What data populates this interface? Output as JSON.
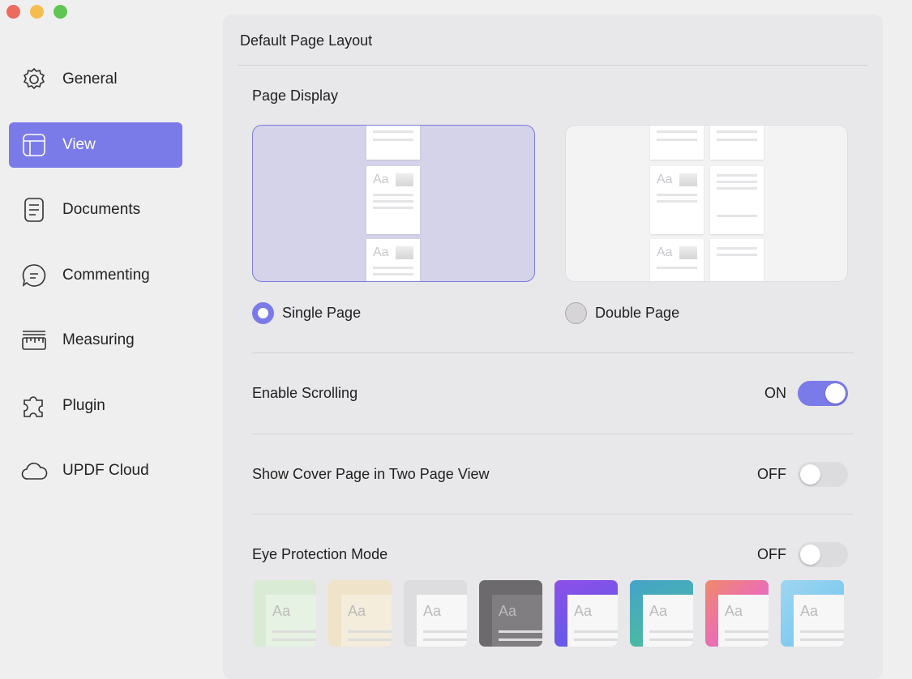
{
  "window": {
    "controls": [
      "close",
      "minimize",
      "zoom"
    ]
  },
  "sidebar": {
    "items": [
      {
        "label": "General",
        "icon": "gear-icon"
      },
      {
        "label": "View",
        "icon": "layout-icon",
        "active": true
      },
      {
        "label": "Documents",
        "icon": "document-icon"
      },
      {
        "label": "Commenting",
        "icon": "comment-icon"
      },
      {
        "label": "Measuring",
        "icon": "ruler-icon"
      },
      {
        "label": "Plugin",
        "icon": "puzzle-icon"
      },
      {
        "label": "UPDF Cloud",
        "icon": "cloud-icon"
      }
    ]
  },
  "panel": {
    "title": "Default Page Layout",
    "page_display": "Page Display",
    "preview_text": "Aa",
    "single_page": "Single Page",
    "double_page": "Double Page",
    "selected": "Single Page",
    "enable_scrolling": {
      "label": "Enable Scrolling",
      "state": "ON"
    },
    "cover_page": {
      "label": "Show Cover Page in Two Page View",
      "state": "OFF"
    },
    "eye_protection": {
      "label": "Eye Protection Mode",
      "state": "OFF"
    }
  },
  "colors": {
    "accent": "#7a7be8",
    "themes": [
      "#d8ebd4",
      "#f0e4c8",
      "#dcdbdd",
      "#6e6c6e",
      "#7a4fe0",
      "#3fa6c0",
      "#e88a8a",
      "#8fd0ef"
    ]
  }
}
